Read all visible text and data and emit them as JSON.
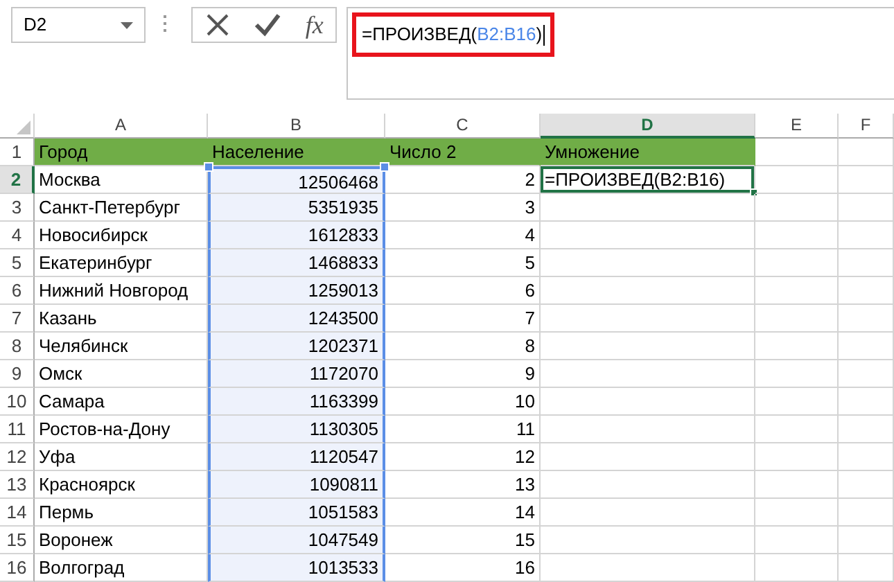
{
  "name_box": {
    "value": "D2"
  },
  "formula_bar": {
    "insert_function": "fx",
    "highlighted": true,
    "formula": {
      "prefix": "=ПРОИЗВЕД(",
      "reference": "B2:B16",
      "suffix": ")"
    }
  },
  "columns": [
    {
      "label": "A",
      "selected": false,
      "referenced": false
    },
    {
      "label": "B",
      "selected": false,
      "referenced": true
    },
    {
      "label": "C",
      "selected": false,
      "referenced": false
    },
    {
      "label": "D",
      "selected": true,
      "referenced": false
    },
    {
      "label": "E",
      "selected": false,
      "referenced": false
    },
    {
      "label": "F",
      "selected": false,
      "referenced": false
    }
  ],
  "rows": [
    {
      "number": "1",
      "kind": "header",
      "selected": false,
      "cells": [
        "Город",
        "Население",
        "Число 2",
        "Умножение"
      ]
    },
    {
      "number": "2",
      "kind": "data",
      "selected": true,
      "cells": [
        "Москва",
        "12506468",
        "2",
        "=ПРОИЗВЕД(B2:B16)"
      ]
    },
    {
      "number": "3",
      "kind": "data",
      "selected": false,
      "cells": [
        "Санкт-Петербург",
        "5351935",
        "3"
      ]
    },
    {
      "number": "4",
      "kind": "data",
      "selected": false,
      "cells": [
        "Новосибирск",
        "1612833",
        "4"
      ]
    },
    {
      "number": "5",
      "kind": "data",
      "selected": false,
      "cells": [
        "Екатеринбург",
        "1468833",
        "5"
      ]
    },
    {
      "number": "6",
      "kind": "data",
      "selected": false,
      "cells": [
        "Нижний Новгород",
        "1259013",
        "6"
      ]
    },
    {
      "number": "7",
      "kind": "data",
      "selected": false,
      "cells": [
        "Казань",
        "1243500",
        "7"
      ]
    },
    {
      "number": "8",
      "kind": "data",
      "selected": false,
      "cells": [
        "Челябинск",
        "1202371",
        "8"
      ]
    },
    {
      "number": "9",
      "kind": "data",
      "selected": false,
      "cells": [
        "Омск",
        "1172070",
        "9"
      ]
    },
    {
      "number": "10",
      "kind": "data",
      "selected": false,
      "cells": [
        "Самара",
        "1163399",
        "10"
      ]
    },
    {
      "number": "11",
      "kind": "data",
      "selected": false,
      "cells": [
        "Ростов-на-Дону",
        "1130305",
        "11"
      ]
    },
    {
      "number": "12",
      "kind": "data",
      "selected": false,
      "cells": [
        "Уфа",
        "1120547",
        "12"
      ]
    },
    {
      "number": "13",
      "kind": "data",
      "selected": false,
      "cells": [
        "Красноярск",
        "1090811",
        "13"
      ]
    },
    {
      "number": "14",
      "kind": "data",
      "selected": false,
      "cells": [
        "Пермь",
        "1051583",
        "14"
      ]
    },
    {
      "number": "15",
      "kind": "data",
      "selected": false,
      "cells": [
        "Воронеж",
        "1047549",
        "15"
      ]
    },
    {
      "number": "16",
      "kind": "data",
      "selected": false,
      "cells": [
        "Волгоград",
        "1013533",
        "16"
      ]
    }
  ]
}
